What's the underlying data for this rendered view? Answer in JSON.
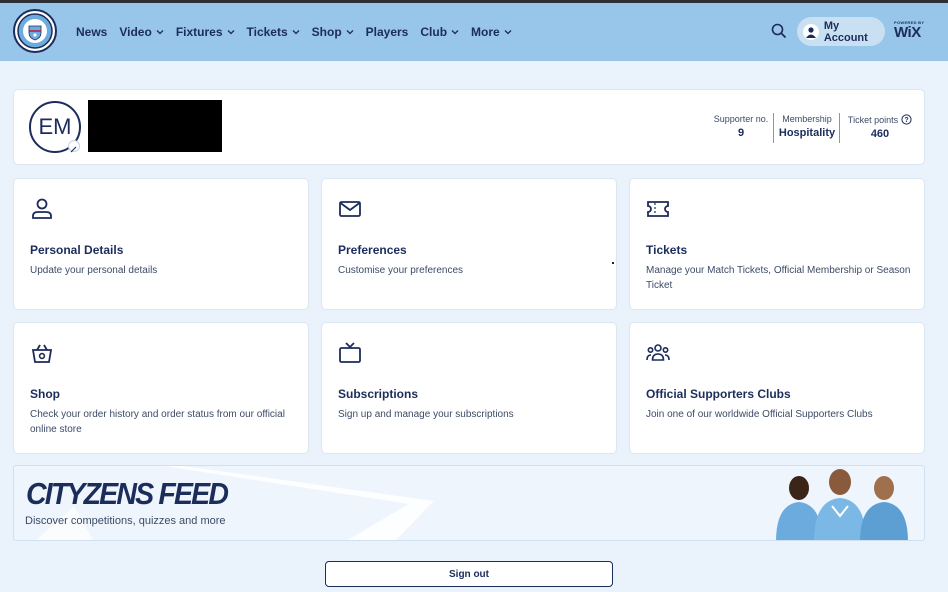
{
  "header": {
    "logo_alt": "Manchester City crest",
    "nav": [
      {
        "label": "News",
        "dropdown": false
      },
      {
        "label": "Video",
        "dropdown": true
      },
      {
        "label": "Fixtures",
        "dropdown": true
      },
      {
        "label": "Tickets",
        "dropdown": true
      },
      {
        "label": "Shop",
        "dropdown": true
      },
      {
        "label": "Players",
        "dropdown": false
      },
      {
        "label": "Club",
        "dropdown": true
      },
      {
        "label": "More",
        "dropdown": true
      }
    ],
    "account_label": "My Account",
    "wix_powered": "POWERED BY",
    "wix_label": "WiX"
  },
  "profile": {
    "initials": "EM",
    "stats": [
      {
        "label": "Supporter no.",
        "value": "9"
      },
      {
        "label": "Membership",
        "value": "Hospitality"
      },
      {
        "label": "Ticket points",
        "value": "460"
      }
    ]
  },
  "tiles": [
    {
      "icon": "person-icon",
      "title": "Personal Details",
      "desc": "Update your personal details"
    },
    {
      "icon": "envelope-icon",
      "title": "Preferences",
      "desc": "Customise your preferences"
    },
    {
      "icon": "ticket-icon",
      "title": "Tickets",
      "desc": "Manage your Match Tickets, Official Membership or Season Ticket"
    },
    {
      "icon": "basket-icon",
      "title": "Shop",
      "desc": "Check your order history and order status from our official online store"
    },
    {
      "icon": "tv-icon",
      "title": "Subscriptions",
      "desc": "Sign up and manage your subscriptions"
    },
    {
      "icon": "group-icon",
      "title": "Official Supporters Clubs",
      "desc": "Join one of our worldwide Official Supporters Clubs"
    }
  ],
  "feed": {
    "title": "CITYZENS FEED",
    "subtitle": "Discover competitions, quizzes and more"
  },
  "signout_label": "Sign out",
  "colors": {
    "header_bg": "#98c5ea",
    "navy": "#1c2c5b",
    "page_bg": "#eaf2fb",
    "sky": "#6cabdd"
  }
}
